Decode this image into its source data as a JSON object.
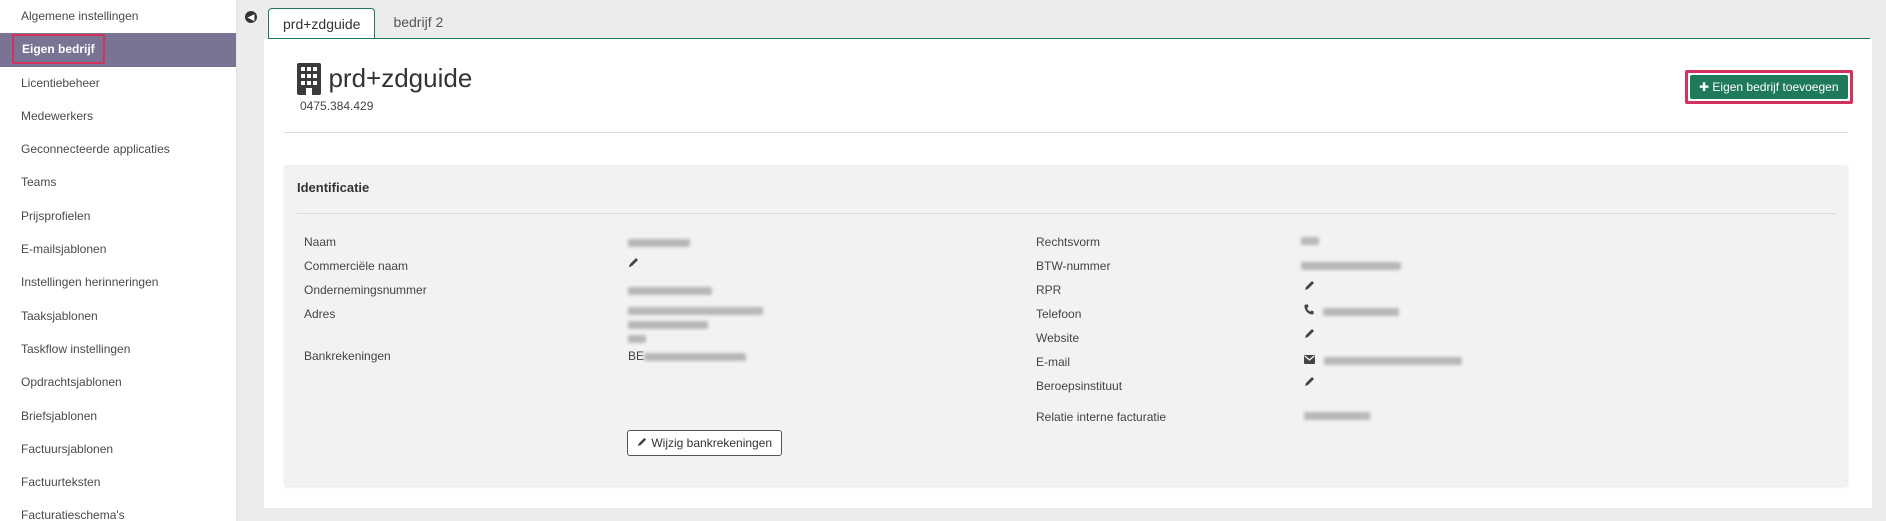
{
  "sidebar": {
    "items": [
      {
        "label": "Algemene instellingen"
      },
      {
        "label": "Eigen bedrijf",
        "active": true
      },
      {
        "label": "Licentiebeheer"
      },
      {
        "label": "Medewerkers"
      },
      {
        "label": "Geconnecteerde applicaties"
      },
      {
        "label": "Teams"
      },
      {
        "label": "Prijsprofielen"
      },
      {
        "label": "E-mailsjablonen"
      },
      {
        "label": "Instellingen herinneringen"
      },
      {
        "label": "Taaksjablonen"
      },
      {
        "label": "Taskflow instellingen"
      },
      {
        "label": "Opdrachtsjablonen"
      },
      {
        "label": "Briefsjablonen"
      },
      {
        "label": "Factuursjablonen"
      },
      {
        "label": "Factuurteksten"
      },
      {
        "label": "Facturatieschema's"
      }
    ]
  },
  "tabs": [
    {
      "label": "prd+zdguide",
      "active": true
    },
    {
      "label": "bedrijf 2",
      "active": false
    }
  ],
  "company": {
    "name": "prd+zdguide",
    "number": "0475.384.429"
  },
  "actions": {
    "add_company": "Eigen bedrijf toevoegen"
  },
  "identification": {
    "title": "Identificatie",
    "left": {
      "naam_label": "Naam",
      "commercial_label": "Commerciële naam",
      "ondernemingsnummer_label": "Ondernemingsnummer",
      "adres_label": "Adres",
      "bank_label": "Bankrekeningen",
      "bank_prefix": "BE",
      "bank_button": "Wijzig bankrekeningen"
    },
    "right": {
      "rechtsvorm_label": "Rechtsvorm",
      "btw_label": "BTW-nummer",
      "rpr_label": "RPR",
      "telefoon_label": "Telefoon",
      "website_label": "Website",
      "email_label": "E-mail",
      "beroeps_label": "Beroepsinstituut",
      "relatie_label": "Relatie interne facturatie"
    }
  },
  "colors": {
    "accent": "#1f7a5b",
    "active_sidebar": "#7a7394",
    "highlight": "#d2335e"
  }
}
